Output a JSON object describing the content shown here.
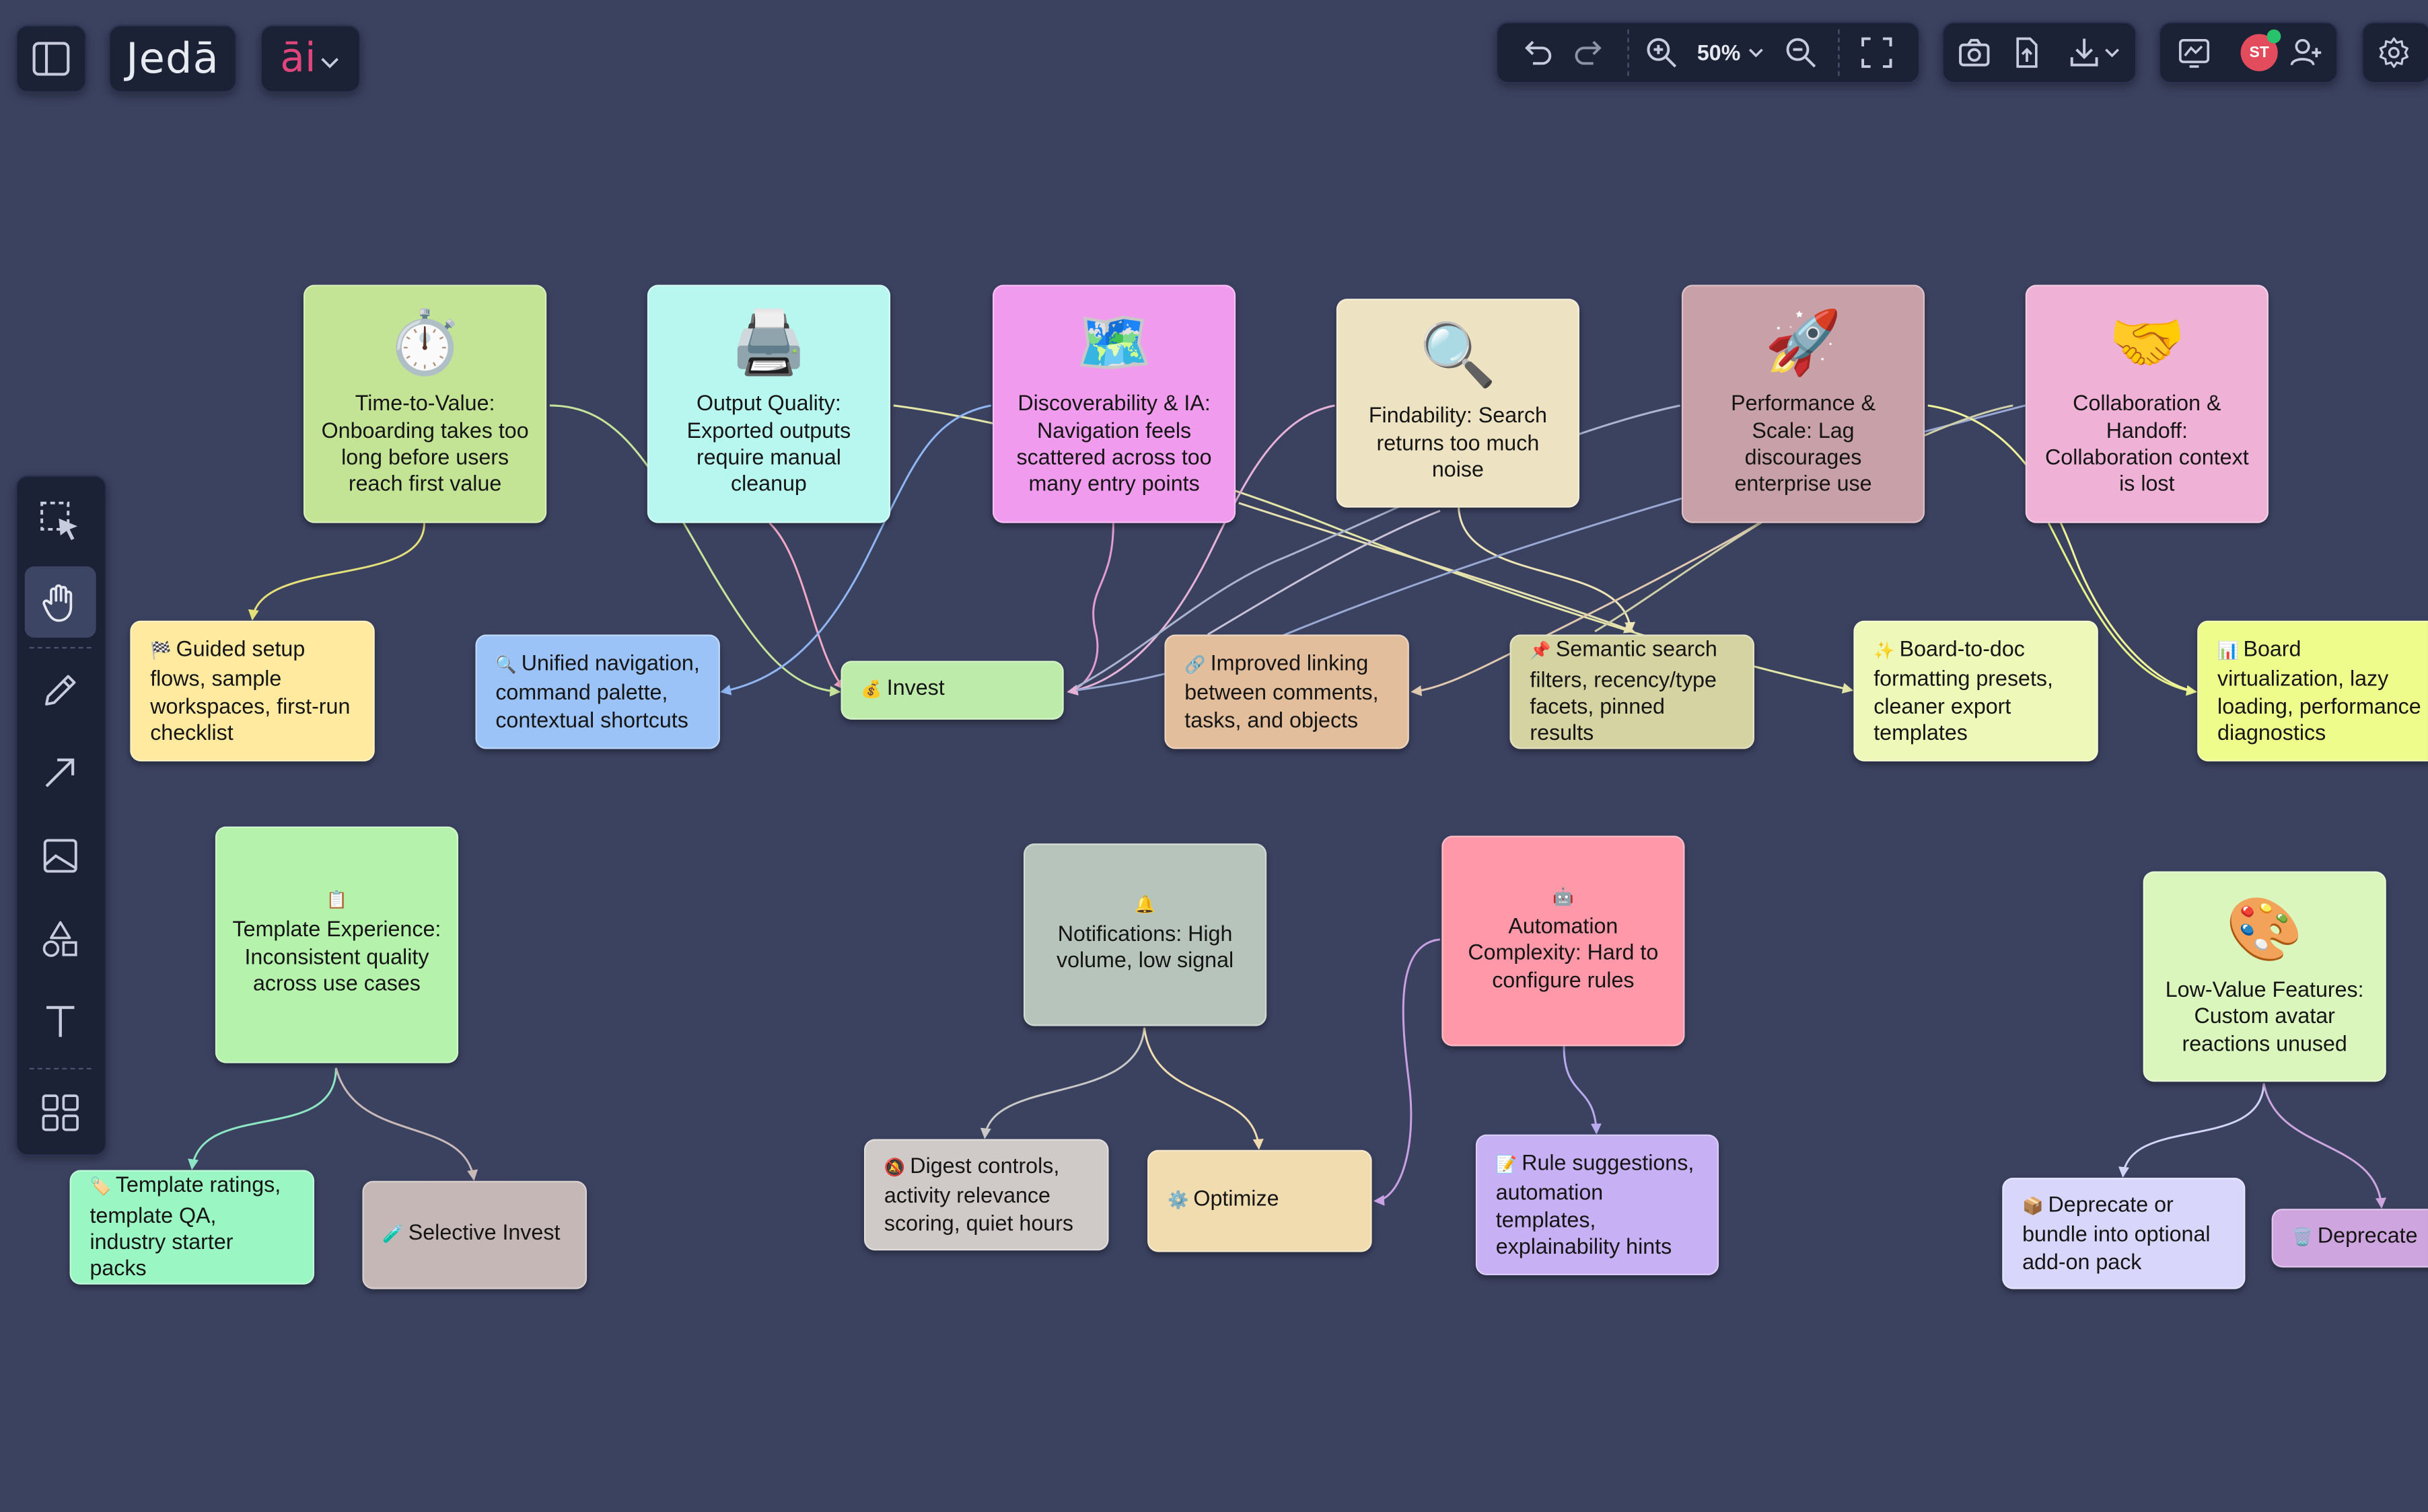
{
  "app": {
    "logo": "Jedā",
    "ai_label": "āi",
    "zoom": "50%",
    "avatar_initials": "ST"
  },
  "toolbar_left": {
    "tools": [
      {
        "name": "select-tool",
        "icon": "selection-cursor-icon"
      },
      {
        "name": "hand-tool",
        "icon": "hand-icon",
        "active": true
      },
      {
        "name": "pen-tool",
        "icon": "pencil-icon"
      },
      {
        "name": "arrow-tool",
        "icon": "arrow-icon"
      },
      {
        "name": "image-tool",
        "icon": "image-icon"
      },
      {
        "name": "shapes-tool",
        "icon": "shapes-icon"
      },
      {
        "name": "text-tool",
        "icon": "text-icon"
      },
      {
        "name": "templates-tool",
        "icon": "grid-icon"
      }
    ]
  },
  "colors": {
    "canvas": "#3b4260",
    "panel": "#1c2236",
    "accent_pink": "#e0457b",
    "avatar": "#e24c5c",
    "presence_dot": "#27c26b"
  },
  "cards": [
    {
      "id": "ttv",
      "emoji": "⏱️",
      "text": "Time-to-Value: Onboarding takes too long before users reach first value",
      "color": "#c3e495"
    },
    {
      "id": "oq",
      "emoji": "🖨️",
      "text": "Output Quality: Exported outputs require manual cleanup",
      "color": "#b8f7ef"
    },
    {
      "id": "dia",
      "emoji": "🗺️",
      "text": "Discoverability & IA: Navigation feels scattered across too many entry points",
      "color": "#f19bef"
    },
    {
      "id": "fs",
      "emoji": "🔍",
      "text": "Findability: Search returns too much noise",
      "color": "#ede3c2"
    },
    {
      "id": "ps",
      "emoji": "🚀",
      "text": "Performance & Scale: Lag discourages enterprise use",
      "color": "#c8a0a8"
    },
    {
      "id": "ch",
      "emoji": "🤝",
      "text": "Collaboration & Handoff: Collaboration context is lost",
      "color": "#efb2d6"
    },
    {
      "id": "gs",
      "glyph": "🏁",
      "text": "Guided setup flows, sample workspaces, first-run checklist",
      "color": "#ffeaa0"
    },
    {
      "id": "un",
      "glyph": "🔍",
      "text": "Unified navigation, command palette, contextual shortcuts",
      "color": "#9bc3f7"
    },
    {
      "id": "inv",
      "glyph": "💰",
      "text": "Invest",
      "color": "#bdeba9"
    },
    {
      "id": "il",
      "glyph": "🔗",
      "text": "Improved linking between comments, tasks, and objects",
      "color": "#e3be9c"
    },
    {
      "id": "ss",
      "glyph": "📌",
      "text": "Semantic search filters, recency/type facets, pinned results",
      "color": "#d6d3a3"
    },
    {
      "id": "bd",
      "glyph": "✨",
      "text": "Board-to-doc formatting presets, cleaner export templates",
      "color": "#eef8b8"
    },
    {
      "id": "bv",
      "glyph": "📊",
      "text": "Board virtualization, lazy loading, performance diagnostics",
      "color": "#eefc8c"
    },
    {
      "id": "te",
      "emoji": "📋",
      "text": "Template Experience: Inconsistent quality across use cases",
      "color": "#b5f3ac"
    },
    {
      "id": "nt",
      "emoji": "🔔",
      "text": "Notifications: High volume, low signal",
      "color": "#b7c4bb"
    },
    {
      "id": "ac",
      "emoji": "🤖",
      "text": "Automation Complexity: Hard to configure rules",
      "color": "#ff98a8"
    },
    {
      "id": "lv",
      "emoji": "🎨",
      "text": "Low-Value Features: Custom avatar reactions unused",
      "color": "#dbf6bd"
    },
    {
      "id": "tr",
      "glyph": "🏷️",
      "text": "Template ratings, template QA, industry starter packs",
      "color": "#9af7c3"
    },
    {
      "id": "si",
      "glyph": "🧪",
      "text": "Selective Invest",
      "color": "#c6b7b7"
    },
    {
      "id": "dc",
      "glyph": "🔕",
      "text": "Digest controls, activity relevance scoring, quiet hours",
      "color": "#cfc9c8"
    },
    {
      "id": "op",
      "glyph": "⚙️",
      "text": "Optimize",
      "color": "#f0dcae"
    },
    {
      "id": "rs",
      "glyph": "📝",
      "text": "Rule suggestions, automation templates, explainability hints",
      "color": "#c7b0f3"
    },
    {
      "id": "db",
      "glyph": "📦",
      "text": "Deprecate or bundle into optional add-on pack",
      "color": "#d9d6fb"
    },
    {
      "id": "dp",
      "glyph": "🗑️",
      "text": "Deprecate",
      "color": "#cfa5e0"
    }
  ]
}
